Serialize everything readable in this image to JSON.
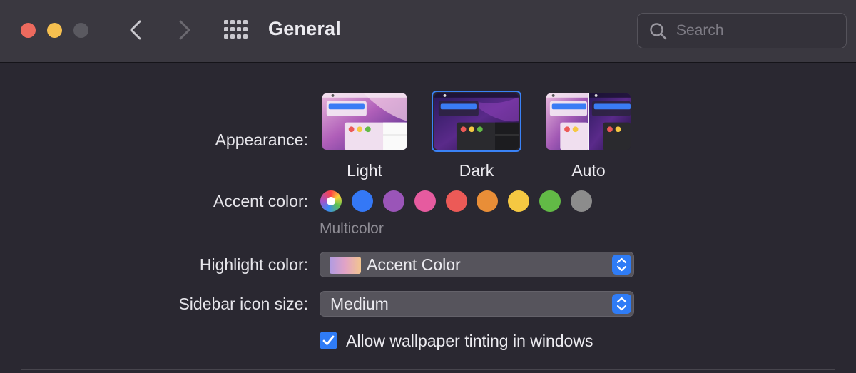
{
  "window": {
    "title": "General",
    "search_placeholder": "Search"
  },
  "appearance": {
    "label": "Appearance:",
    "options": [
      {
        "label": "Light",
        "selected": false
      },
      {
        "label": "Dark",
        "selected": true
      },
      {
        "label": "Auto",
        "selected": false
      }
    ]
  },
  "accent": {
    "label": "Accent color:",
    "selected_name": "Multicolor",
    "swatches": [
      {
        "name": "multicolor",
        "color": "multicolor"
      },
      {
        "name": "blue",
        "color": "#3478f6"
      },
      {
        "name": "purple",
        "color": "#9a55b8"
      },
      {
        "name": "pink",
        "color": "#e65b9f"
      },
      {
        "name": "red",
        "color": "#ec5a57"
      },
      {
        "name": "orange",
        "color": "#e98e37"
      },
      {
        "name": "yellow",
        "color": "#f5c842"
      },
      {
        "name": "green",
        "color": "#62ba46"
      },
      {
        "name": "graphite",
        "color": "#8c8c8c"
      }
    ]
  },
  "highlight": {
    "label": "Highlight color:",
    "value": "Accent Color"
  },
  "sidebar_icon_size": {
    "label": "Sidebar icon size:",
    "value": "Medium"
  },
  "wallpaper_tinting": {
    "label": "Allow wallpaper tinting in windows",
    "checked": true
  },
  "colors": {
    "accent_blue": "#2f7cf6",
    "window_bg": "#2a2831",
    "titlebar_bg": "#3a3840"
  }
}
